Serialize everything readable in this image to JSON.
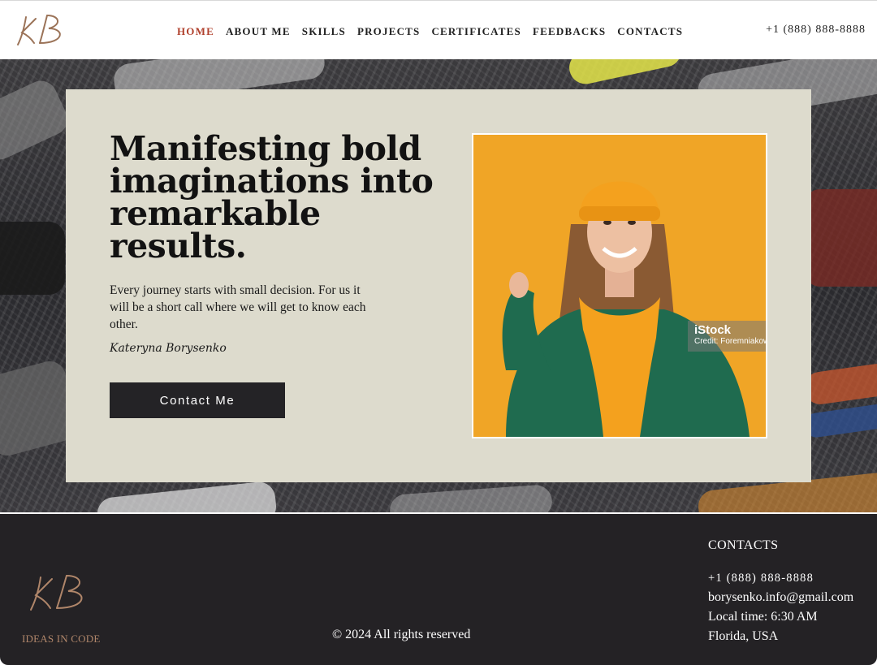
{
  "header": {
    "logo_text": "KB",
    "nav": [
      {
        "label": "HOME",
        "active": true
      },
      {
        "label": "ABOUT ME",
        "active": false
      },
      {
        "label": "SKILLS",
        "active": false
      },
      {
        "label": "PROJECTS",
        "active": false
      },
      {
        "label": "CERTIFICATES",
        "active": false
      },
      {
        "label": "FEEDBACKS",
        "active": false
      },
      {
        "label": "CONTACTS",
        "active": false
      }
    ],
    "phone": "+1 (888) 888-8888"
  },
  "hero": {
    "headline": "Manifesting bold imaginations into remarkable results.",
    "intro": "Every journey starts with small decision. For us it will be a short call where we will get to know each other.",
    "signature": "Kateryna Borysenko",
    "cta_label": "Contact Me",
    "photo_watermark": {
      "brand": "iStock",
      "credit": "Credit: Foremniakow"
    }
  },
  "footer": {
    "logo_text": "KB",
    "tagline": "IDEAS IN CODE",
    "copyright": "© 2024 All rights reserved",
    "contacts": {
      "title": "CONTACTS",
      "phone": "+1 (888) 888-8888",
      "email": "borysenko.info@gmail.com",
      "local_time": "Local time: 6:30 AM",
      "location": "Florida, USA"
    }
  },
  "colors": {
    "accent_active_nav": "#b0402c",
    "card_background": "#dddbcd",
    "button_background": "#242326",
    "footer_background": "#242225",
    "tagline_color": "#b0866a",
    "photo_background": "#f0a526"
  }
}
